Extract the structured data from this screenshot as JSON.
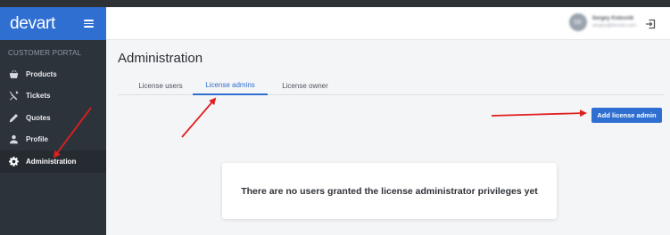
{
  "brand": {
    "logo_text": "devart"
  },
  "sidebar": {
    "section_title": "CUSTOMER PORTAL",
    "items": [
      {
        "label": "Products",
        "icon": "basket-icon",
        "active": false
      },
      {
        "label": "Tickets",
        "icon": "tools-icon",
        "active": false
      },
      {
        "label": "Quotes",
        "icon": "pencil-icon",
        "active": false
      },
      {
        "label": "Profile",
        "icon": "person-icon",
        "active": false
      },
      {
        "label": "Administration",
        "icon": "gear-icon",
        "active": true
      }
    ]
  },
  "header": {
    "avatar_initials": "SK",
    "user_name": "Sergey Kolesnik",
    "user_email": "sergey@devart.com"
  },
  "page": {
    "title": "Administration",
    "tabs": [
      {
        "label": "License users",
        "active": false
      },
      {
        "label": "License admins",
        "active": true
      },
      {
        "label": "License owner",
        "active": false
      }
    ],
    "add_button_label": "Add license admin",
    "empty_message": "There are no users granted the license administrator privileges yet"
  },
  "colors": {
    "accent": "#2f6fd1",
    "sidebar_bg": "#2d333b",
    "annotation_arrow": "#e02020"
  }
}
